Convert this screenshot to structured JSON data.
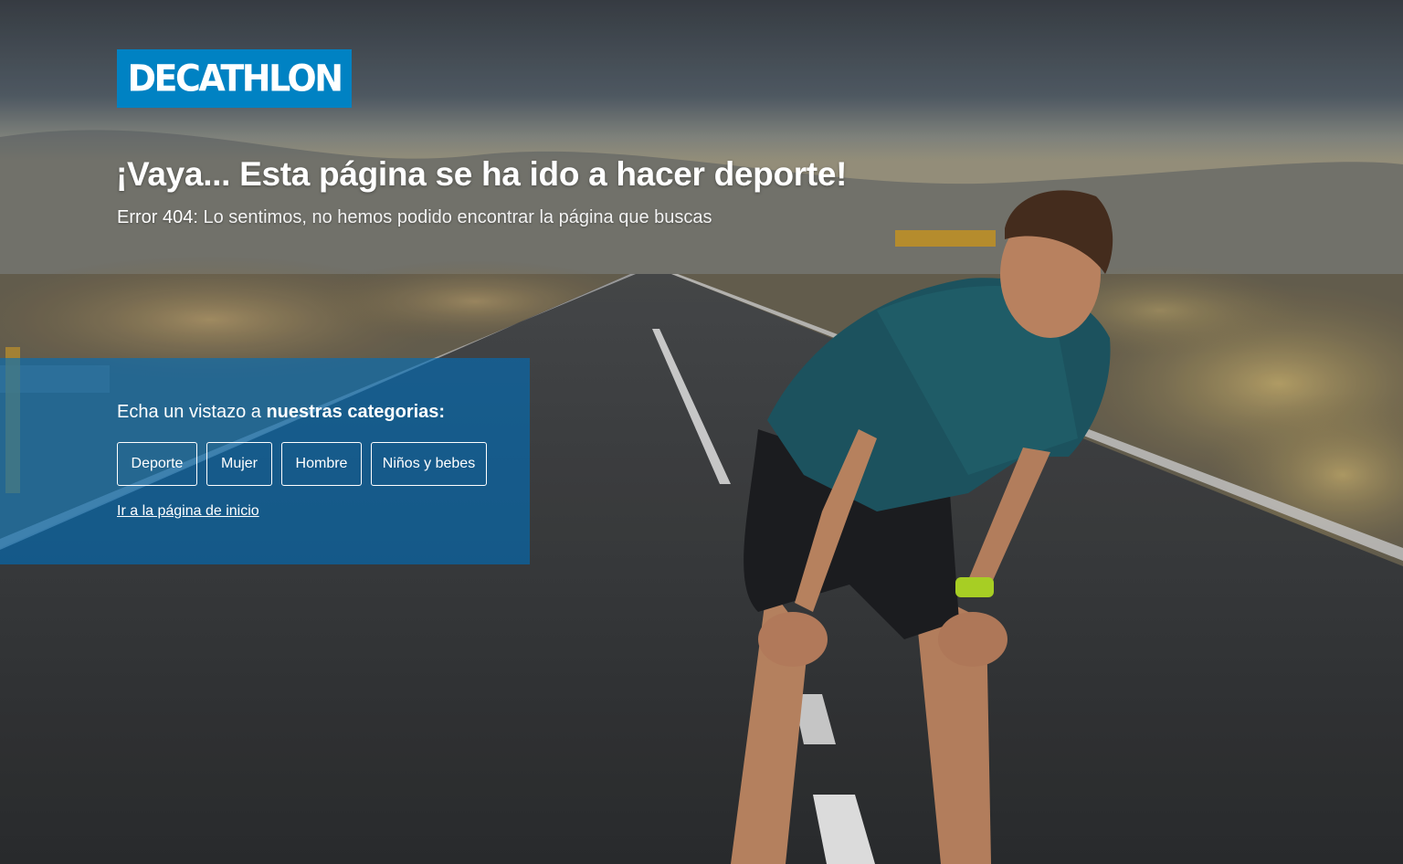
{
  "brand": {
    "logo_text": "DECATHLON",
    "color": "#0082c3"
  },
  "error": {
    "headline": "¡Vaya... Esta página se ha ido a hacer deporte!",
    "code_label": "Error 404:",
    "message": " Lo sentimos, no hemos podido encontrar la página que buscas"
  },
  "categories": {
    "intro": "Echa un vistazo a ",
    "intro_strong": "nuestras categorias:",
    "items": [
      {
        "label": "Deporte"
      },
      {
        "label": "Mujer"
      },
      {
        "label": "Hombre"
      },
      {
        "label": "Niños y bebes"
      }
    ],
    "home_link": "Ir a la página de inicio"
  },
  "background": {
    "description_icon": "runner-on-road-photo"
  }
}
